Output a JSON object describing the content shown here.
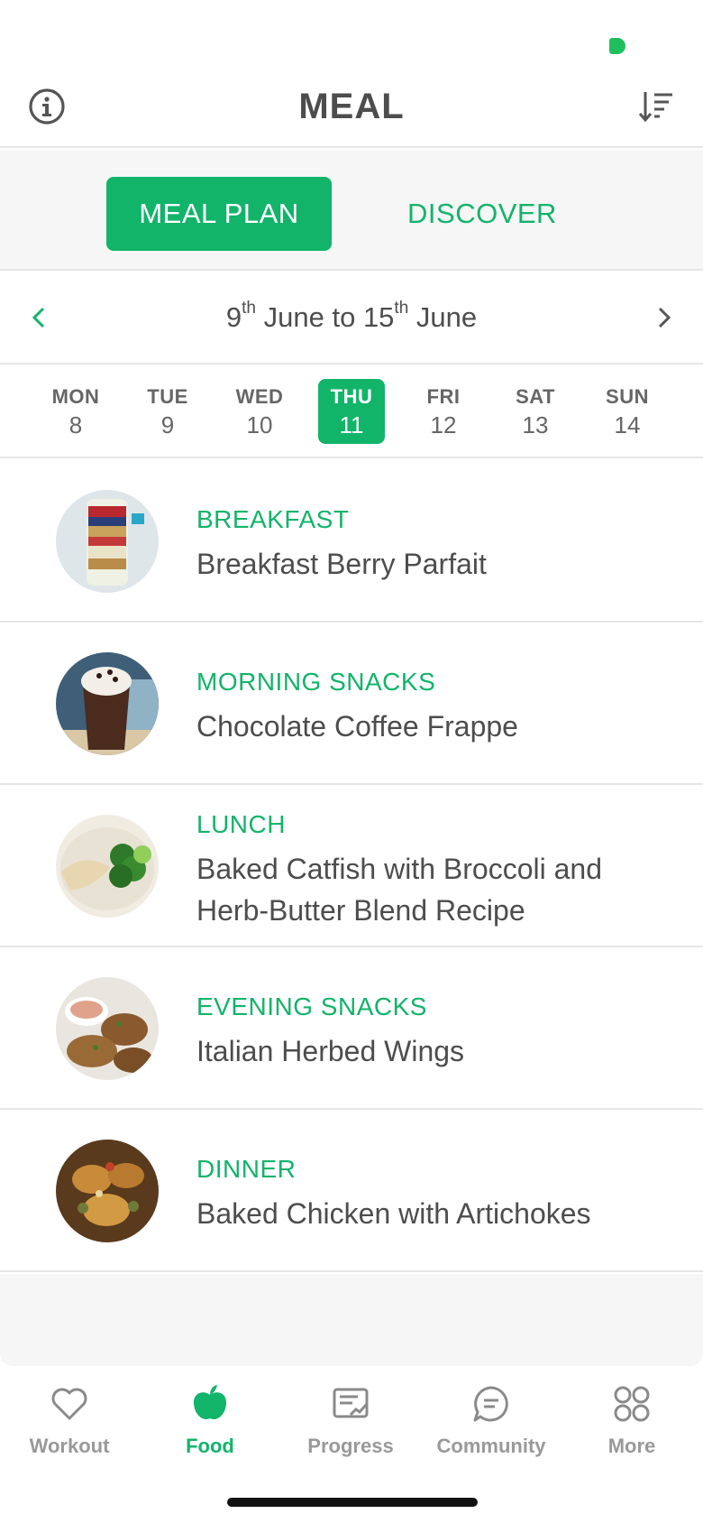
{
  "status_bar": {
    "indicator_color": "#1fbf5e"
  },
  "header": {
    "title": "MEAL",
    "left_icon": "info-icon",
    "right_icon": "sort-icon"
  },
  "segment": {
    "active": "MEAL PLAN",
    "plan_label": "MEAL PLAN",
    "discover_label": "DISCOVER"
  },
  "week": {
    "start_day": "9",
    "start_suffix": "th",
    "start_month": "June",
    "connector": "to",
    "end_day": "15",
    "end_suffix": "th",
    "end_month": "June"
  },
  "days": [
    {
      "name": "MON",
      "num": "8",
      "active": false
    },
    {
      "name": "TUE",
      "num": "9",
      "active": false
    },
    {
      "name": "WED",
      "num": "10",
      "active": false
    },
    {
      "name": "THU",
      "num": "11",
      "active": true
    },
    {
      "name": "FRI",
      "num": "12",
      "active": false
    },
    {
      "name": "SAT",
      "num": "13",
      "active": false
    },
    {
      "name": "SUN",
      "num": "14",
      "active": false
    }
  ],
  "meals": [
    {
      "category": "BREAKFAST",
      "name": "Breakfast Berry Parfait"
    },
    {
      "category": "MORNING SNACKS",
      "name": "Chocolate Coffee Frappe"
    },
    {
      "category": "LUNCH",
      "name": "Baked Catfish with Broccoli and Herb-Butter Blend Recipe"
    },
    {
      "category": "EVENING SNACKS",
      "name": "Italian Herbed Wings"
    },
    {
      "category": "DINNER",
      "name": "Baked Chicken with Artichokes"
    }
  ],
  "tabs": [
    {
      "label": "Workout",
      "icon": "heart-icon",
      "active": false
    },
    {
      "label": "Food",
      "icon": "apple-icon",
      "active": true
    },
    {
      "label": "Progress",
      "icon": "progress-chart-icon",
      "active": false
    },
    {
      "label": "Community",
      "icon": "chat-bubble-icon",
      "active": false
    },
    {
      "label": "More",
      "icon": "grid-icon",
      "active": false
    }
  ],
  "colors": {
    "accent": "#12b46a",
    "text": "#4d4d4d",
    "muted": "#999999",
    "divider": "#e6e6e6"
  }
}
